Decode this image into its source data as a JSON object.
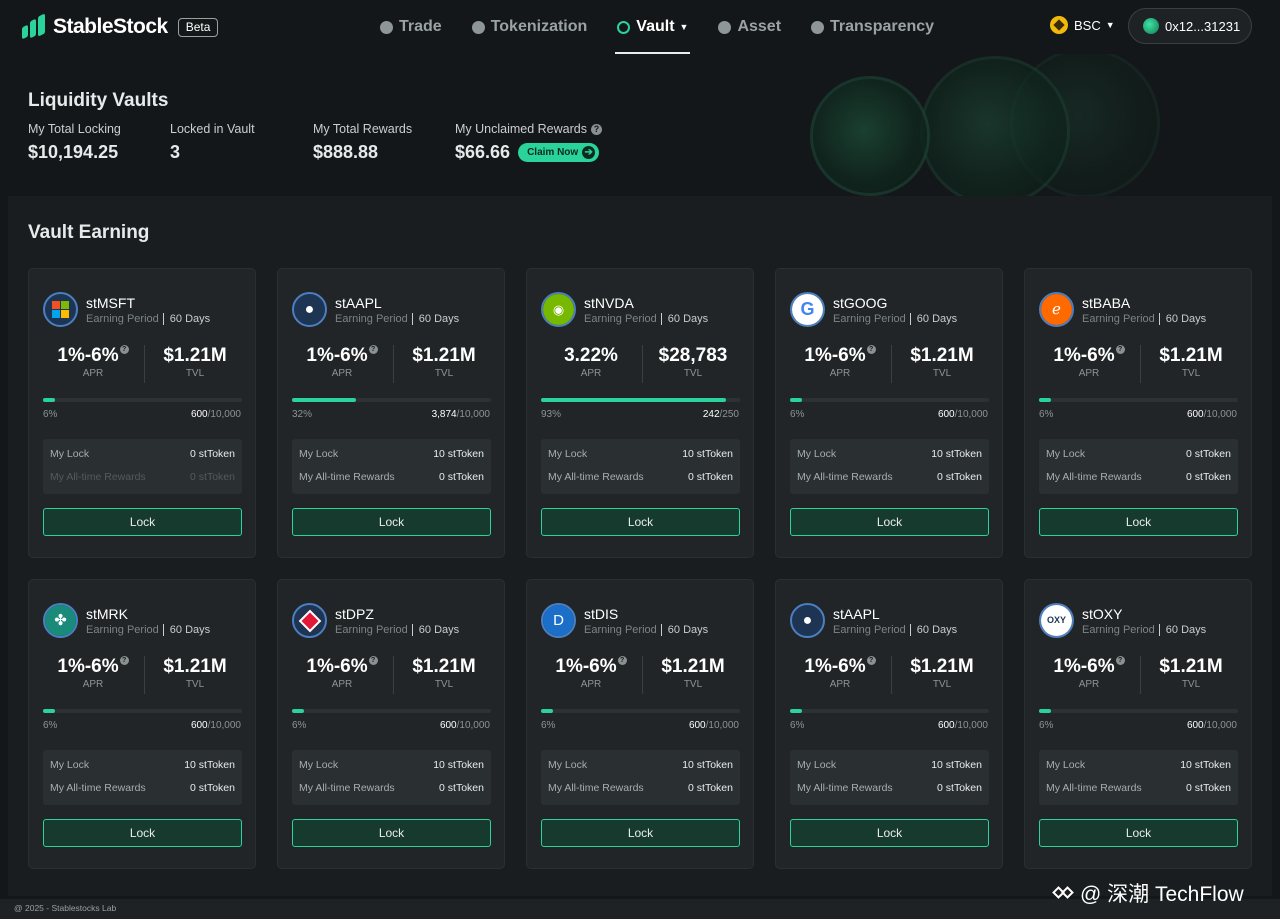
{
  "brand": {
    "name": "StableStock",
    "badge": "Beta"
  },
  "nav": [
    {
      "label": "Trade",
      "icon": "trade-icon"
    },
    {
      "label": "Tokenization",
      "icon": "tokenization-icon"
    },
    {
      "label": "Vault",
      "icon": "vault-icon",
      "active": true
    },
    {
      "label": "Asset",
      "icon": "asset-icon"
    },
    {
      "label": "Transparency",
      "icon": "transparency-icon"
    }
  ],
  "chain": {
    "label": "BSC"
  },
  "wallet": {
    "address": "0x12...31231"
  },
  "hero": {
    "title": "Liquidity Vaults",
    "stats": [
      {
        "label": "My Total Locking",
        "value": "$10,194.25"
      },
      {
        "label": "Locked in Vault",
        "value": "3"
      },
      {
        "label": "My Total Rewards",
        "value": "$888.88"
      },
      {
        "label": "My Unclaimed Rewards",
        "value": "$66.66"
      }
    ],
    "claim_label": "Claim Now"
  },
  "section_title": "Vault Earning",
  "labels": {
    "earning_period": "Earning Period",
    "apr": "APR",
    "tvl": "TVL",
    "my_lock": "My Lock",
    "rewards": "My All-time Rewards",
    "lock_button": "Lock"
  },
  "colors": {
    "accent": "#2ad39a",
    "background": "#141719",
    "card": "#212527"
  },
  "vaults": [
    {
      "symbol": "stMSFT",
      "period": "60 Days",
      "apr": "1%-6%",
      "tvl": "$1.21M",
      "progress_pct": 6,
      "progress_label": "6%",
      "filled": "600",
      "total": "/10,000",
      "my_lock": "0 stToken",
      "rewards": "0 stToken",
      "dim_rewards": true,
      "logo": "microsoft-logo"
    },
    {
      "symbol": "stAAPL",
      "period": "60 Days",
      "apr": "1%-6%",
      "tvl": "$1.21M",
      "progress_pct": 32,
      "progress_label": "32%",
      "filled": "3,874",
      "total": "/10,000",
      "my_lock": "10 stToken",
      "rewards": "0 stToken",
      "logo": "apple-logo"
    },
    {
      "symbol": "stNVDA",
      "period": "60 Days",
      "apr": "3.22%",
      "tvl": "$28,783",
      "progress_pct": 93,
      "progress_label": "93%",
      "filled": "242",
      "total": "/250",
      "my_lock": "10 stToken",
      "rewards": "0 stToken",
      "logo": "nvidia-logo"
    },
    {
      "symbol": "stGOOG",
      "period": "60 Days",
      "apr": "1%-6%",
      "tvl": "$1.21M",
      "progress_pct": 6,
      "progress_label": "6%",
      "filled": "600",
      "total": "/10,000",
      "my_lock": "10 stToken",
      "rewards": "0 stToken",
      "logo": "google-logo"
    },
    {
      "symbol": "stBABA",
      "period": "60 Days",
      "apr": "1%-6%",
      "tvl": "$1.21M",
      "progress_pct": 6,
      "progress_label": "6%",
      "filled": "600",
      "total": "/10,000",
      "my_lock": "0 stToken",
      "rewards": "0 stToken",
      "logo": "alibaba-logo"
    },
    {
      "symbol": "stMRK",
      "period": "60 Days",
      "apr": "1%-6%",
      "tvl": "$1.21M",
      "progress_pct": 6,
      "progress_label": "6%",
      "filled": "600",
      "total": "/10,000",
      "my_lock": "10 stToken",
      "rewards": "0 stToken",
      "logo": "merck-logo"
    },
    {
      "symbol": "stDPZ",
      "period": "60 Days",
      "apr": "1%-6%",
      "tvl": "$1.21M",
      "progress_pct": 6,
      "progress_label": "6%",
      "filled": "600",
      "total": "/10,000",
      "my_lock": "10 stToken",
      "rewards": "0 stToken",
      "logo": "dominos-logo"
    },
    {
      "symbol": "stDIS",
      "period": "60 Days",
      "apr": "1%-6%",
      "tvl": "$1.21M",
      "progress_pct": 6,
      "progress_label": "6%",
      "filled": "600",
      "total": "/10,000",
      "my_lock": "10 stToken",
      "rewards": "0 stToken",
      "logo": "disney-logo"
    },
    {
      "symbol": "stAAPL",
      "period": "60 Days",
      "apr": "1%-6%",
      "tvl": "$1.21M",
      "progress_pct": 6,
      "progress_label": "6%",
      "filled": "600",
      "total": "/10,000",
      "my_lock": "10 stToken",
      "rewards": "0 stToken",
      "logo": "apple-logo"
    },
    {
      "symbol": "stOXY",
      "period": "60 Days",
      "apr": "1%-6%",
      "tvl": "$1.21M",
      "progress_pct": 6,
      "progress_label": "6%",
      "filled": "600",
      "total": "/10,000",
      "my_lock": "10 stToken",
      "rewards": "0 stToken",
      "logo": "oxy-logo"
    }
  ],
  "footer": {
    "copyright": "@ 2025 - Stablestocks Lab"
  },
  "watermark": {
    "text": "@ 深潮 TechFlow"
  }
}
